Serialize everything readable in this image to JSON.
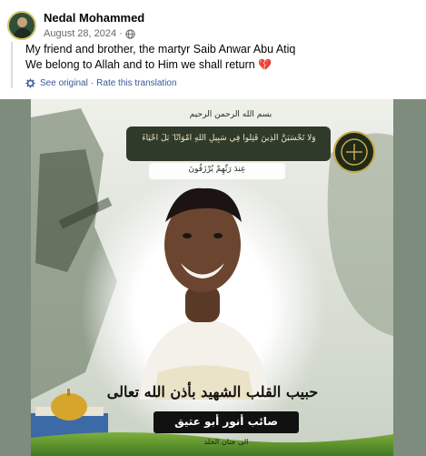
{
  "post": {
    "author": "Nedal Mohammed",
    "date": "August 28, 2024",
    "separator": "·",
    "lines": [
      "My friend and brother, the martyr Saib Anwar Abu Atiq",
      "We belong to Allah and to Him we shall return"
    ],
    "heart_emoji": "💔",
    "see_original": "See original",
    "translate_separator": "·",
    "rate_translation": "Rate this translation"
  },
  "poster": {
    "quran_verse": "وَلَا تَحْسَبَنَّ الَّذِينَ قُتِلُوا فِي سَبِيلِ اللَّهِ أَمْوَاتًا ۚ بَلْ أَحْيَاءٌ",
    "quran_verse_2": "عِندَ رَبِّهِمْ يُرْزَقُونَ",
    "bismillah": "بسم الله الرحمن الرحيم",
    "title_line": "حبيب القلب الشهيد بأذن الله تعالى",
    "name": "صائب أنور أبو عتيق",
    "footer": "الى جنان الخلد"
  },
  "colors": {
    "link": "#385898",
    "secondary_text": "#65676b",
    "heart": "#e2264d",
    "background_gray": "#7d8c7d"
  },
  "icons": {
    "privacy": "globe-icon",
    "translation": "gear-icon",
    "emblem": "emblem-icon"
  }
}
